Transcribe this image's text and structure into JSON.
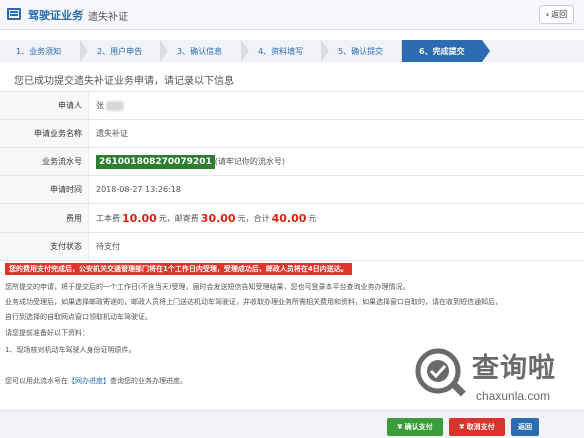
{
  "header": {
    "title": "驾驶证业务",
    "separator": "/",
    "subtitle": "遗失补证",
    "back_label": "返回"
  },
  "steps": [
    {
      "label": "1、业务须知",
      "active": false
    },
    {
      "label": "2、用户申告",
      "active": false
    },
    {
      "label": "3、确认信息",
      "active": false
    },
    {
      "label": "4、资料填写",
      "active": false
    },
    {
      "label": "5、确认提交",
      "active": false
    },
    {
      "label": "6、完成提交",
      "active": true
    }
  ],
  "main": {
    "heading": "您已成功提交遗失补证业务申请，请记录以下信息",
    "rows": {
      "applicant": {
        "label": "申请人",
        "value": "张"
      },
      "business": {
        "label": "申请业务名称",
        "value": "遗失补证"
      },
      "serial": {
        "label": "业务流水号",
        "value": "261001808270079201",
        "hint": "(请牢记你的流水号)"
      },
      "time": {
        "label": "申请时间",
        "value": "2018-08-27 13:26:18"
      },
      "fee": {
        "label": "费用",
        "cost_label": "工本费",
        "cost_value": "10.00",
        "postage_label": "，邮寄费",
        "postage_value": "30.00",
        "total_label": "，合计",
        "total_value": "40.00",
        "unit": "元"
      },
      "payment": {
        "label": "支付状态",
        "value": "待支付"
      }
    },
    "notice": "您的费用支付完成后，公安机关交通管理部门将在1个工作日内受理，受理成功后，邮政人员将在4日内送达。",
    "paragraphs": [
      "您所提交的申请，将于提交后的一个工作日(不含当天)受理，届时会发送短信告知受理结果，您也可登录本平台查询业务办理情况。",
      "业务成功受理后，如果选择邮政寄递的，邮政人员将上门送达机动车驾驶证，并收取办理业务所需相关费用和资料，如果选择窗口自取的，请在收到短信通知后，",
      "自行到选择的自取网点窗口领取机动车驾驶证。",
      "请您提前准备好以下资料：",
      "1、现场核对机动车驾驶人身份证明原件。"
    ],
    "query_prefix": "您可以用此流水号在",
    "query_link": "【网办进度】",
    "query_suffix": "查询您的业务办理进度。"
  },
  "footer": {
    "confirm_pay": "¥ 确认支付",
    "cancel_pay": "¥ 取消支付",
    "back": "返回"
  },
  "watermark": {
    "text": "查询啦",
    "url": "chaxunla.com"
  }
}
